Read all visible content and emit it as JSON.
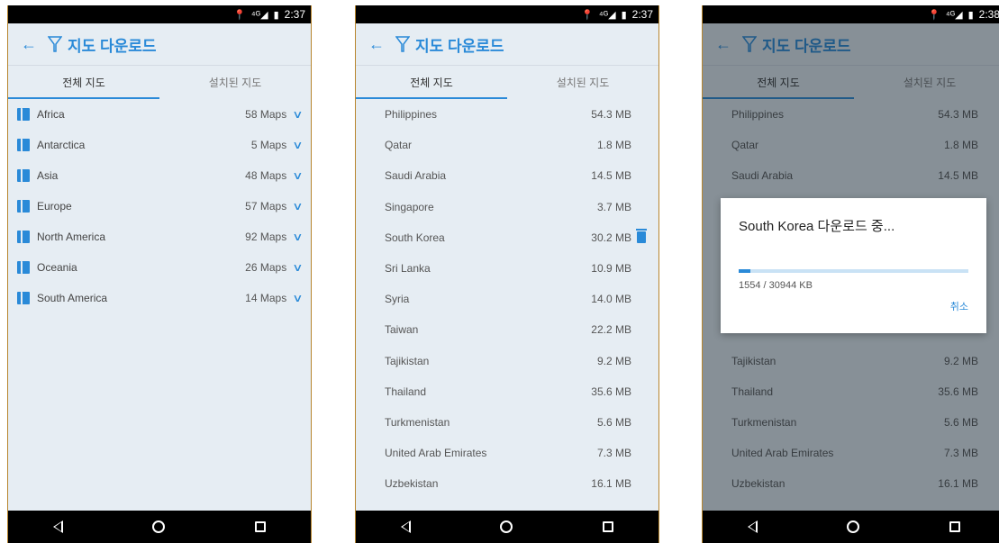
{
  "status": {
    "time1": "2:37",
    "time2": "2:37",
    "time3": "2:38",
    "signal": "⁴ᴳ◢"
  },
  "appbar": {
    "title": "지도 다운로드"
  },
  "tabs": [
    "전체 지도",
    "설치된 지도"
  ],
  "continents": [
    {
      "name": "Africa",
      "count": "58 Maps"
    },
    {
      "name": "Antarctica",
      "count": "5 Maps"
    },
    {
      "name": "Asia",
      "count": "48 Maps"
    },
    {
      "name": "Europe",
      "count": "57 Maps"
    },
    {
      "name": "North America",
      "count": "92 Maps"
    },
    {
      "name": "Oceania",
      "count": "26 Maps"
    },
    {
      "name": "South America",
      "count": "14 Maps"
    }
  ],
  "countries": [
    {
      "name": "Philippines",
      "size": "54.3 MB"
    },
    {
      "name": "Qatar",
      "size": "1.8 MB"
    },
    {
      "name": "Saudi Arabia",
      "size": "14.5 MB"
    },
    {
      "name": "Singapore",
      "size": "3.7 MB"
    },
    {
      "name": "South Korea",
      "size": "30.2 MB"
    },
    {
      "name": "Sri Lanka",
      "size": "10.9 MB"
    },
    {
      "name": "Syria",
      "size": "14.0 MB"
    },
    {
      "name": "Taiwan",
      "size": "22.2 MB"
    },
    {
      "name": "Tajikistan",
      "size": "9.2 MB"
    },
    {
      "name": "Thailand",
      "size": "35.6 MB"
    },
    {
      "name": "Turkmenistan",
      "size": "5.6 MB"
    },
    {
      "name": "United Arab Emirates",
      "size": "7.3 MB"
    },
    {
      "name": "Uzbekistan",
      "size": "16.1 MB"
    }
  ],
  "dialog": {
    "title": "South Korea 다운로드 중...",
    "progress_text": "1554 / 30944 KB",
    "progress_fraction": 0.05,
    "cancel": "취소"
  },
  "colors": {
    "accent": "#2a8ad8",
    "background": "#e6edf3"
  }
}
